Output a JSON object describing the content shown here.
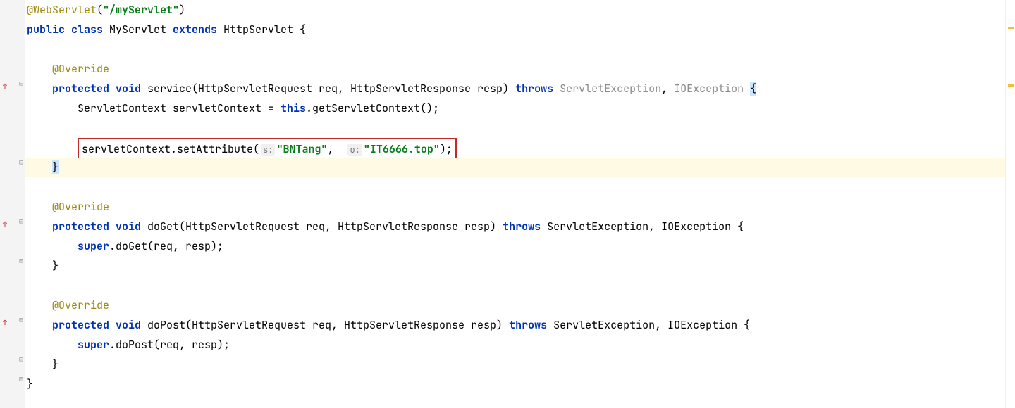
{
  "code": {
    "line1": {
      "anno": "@WebServlet",
      "paren_open": "(",
      "str": "\"/myServlet\"",
      "paren_close": ")"
    },
    "line2": {
      "kw1": "public class ",
      "cls": "MyServlet ",
      "kw2": "extends ",
      "ext": "HttpServlet {"
    },
    "line4": {
      "anno": "@Override"
    },
    "line5": {
      "kw1": "protected void ",
      "mtd": "service",
      "sig": "(HttpServletRequest req, HttpServletResponse resp) ",
      "kw2": "throws ",
      "ex1": "ServletException",
      "comma": ", ",
      "ex2": "IOException ",
      "brace": "{"
    },
    "line6": {
      "t1": "ServletContext servletContext = ",
      "kw": "this",
      "t2": ".getServletContext();"
    },
    "line8": {
      "t1": "servletContext.setAttribute(",
      "hint1": "s:",
      "str1": "\"BNTang\"",
      "comma": ",  ",
      "hint2": "o:",
      "str2": "\"IT6666.top\"",
      "t2": ");"
    },
    "line9": {
      "brace": "}"
    },
    "line11": {
      "anno": "@Override"
    },
    "line12": {
      "kw1": "protected void ",
      "mtd": "doGet",
      "sig": "(HttpServletRequest req, HttpServletResponse resp) ",
      "kw2": "throws ",
      "ex": "ServletException, IOException {"
    },
    "line13": {
      "kw": "super",
      "t": ".doGet(req, resp);"
    },
    "line14": {
      "brace": "}"
    },
    "line16": {
      "anno": "@Override"
    },
    "line17": {
      "kw1": "protected void ",
      "mtd": "doPost",
      "sig": "(HttpServletRequest req, HttpServletResponse resp) ",
      "kw2": "throws ",
      "ex": "ServletException, IOException {"
    },
    "line18": {
      "kw": "super",
      "t": ".doPost(req, resp);"
    },
    "line19": {
      "brace": "}"
    },
    "line20": {
      "brace": "}"
    }
  },
  "gutter": {
    "override_arrow": "↑",
    "fold_minus": "⊟",
    "fold_end": "⊟"
  }
}
